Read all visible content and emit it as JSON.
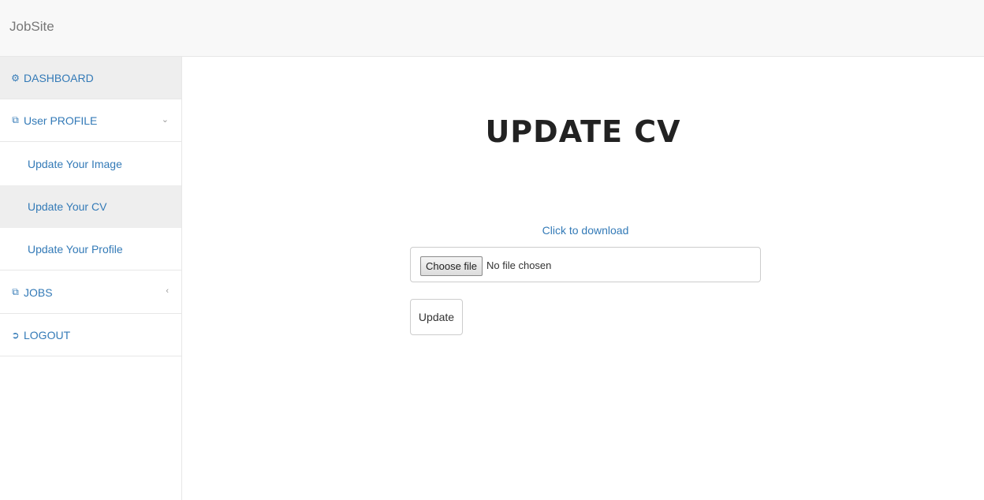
{
  "app": {
    "brand": "JobSite"
  },
  "sidebar": {
    "dashboard": {
      "label": "DASHBOARD",
      "icon": "dashboard-icon"
    },
    "user_profile": {
      "label": "User PROFILE",
      "icon": "files-icon",
      "expanded": true,
      "items": [
        {
          "label": "Update Your Image"
        },
        {
          "label": "Update Your CV",
          "active": true
        },
        {
          "label": "Update Your Profile"
        }
      ]
    },
    "jobs": {
      "label": "JOBS",
      "icon": "files-icon",
      "expanded": false
    },
    "logout": {
      "label": "LOGOUT",
      "icon": "logout-icon"
    }
  },
  "main": {
    "title": "UPDATE CV",
    "download_link": "Click to download",
    "file_input": {
      "button_label": "Choose file",
      "status": "No file chosen"
    },
    "submit_label": "Update"
  },
  "colors": {
    "link": "#337ab7",
    "active_bg": "#eeeeee",
    "navbar_bg": "#f8f8f8"
  }
}
